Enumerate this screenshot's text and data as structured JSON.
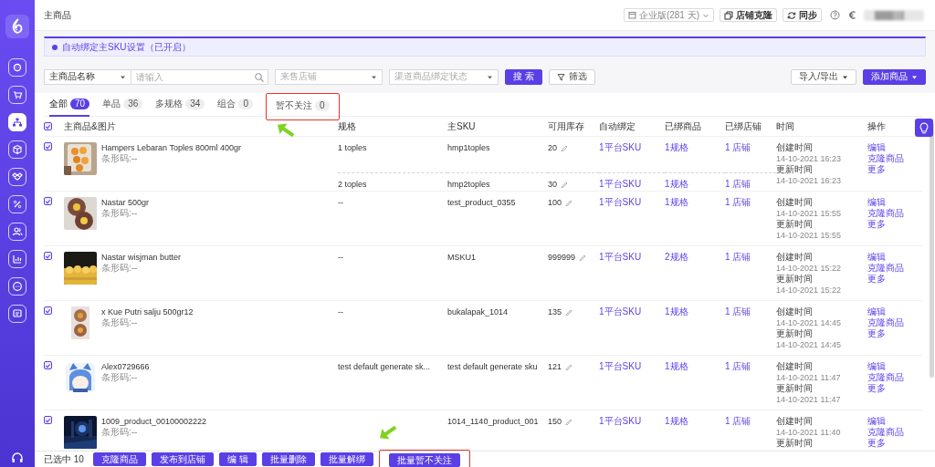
{
  "page_title": "主商品",
  "header": {
    "plan": "企业版(281 天)",
    "clone_button": "店铺克隆",
    "sync_button": "同步"
  },
  "sidebar": {
    "items": [
      {
        "selected": false
      },
      {
        "selected": false
      },
      {
        "selected": true
      },
      {
        "selected": false
      },
      {
        "selected": false
      },
      {
        "selected": false
      },
      {
        "selected": false
      },
      {
        "selected": false
      },
      {
        "selected": false
      },
      {
        "selected": false
      }
    ]
  },
  "notice": "自动绑定主SKU设置（已开启）",
  "filters": {
    "field_select": "主商品名称",
    "keyword_placeholder": "请输入",
    "shop_placeholder": "来售店铺",
    "bind_status_placeholder": "渠道商品绑定状态",
    "search_button": "搜 索",
    "filter_button": "筛选",
    "import_export": "导入/导出",
    "add_product": "添加商品"
  },
  "tabs": [
    {
      "label": "全部",
      "count": "70",
      "selected": true,
      "highlighted": false
    },
    {
      "label": "单品",
      "count": "36",
      "selected": false,
      "highlighted": false
    },
    {
      "label": "多规格",
      "count": "34",
      "selected": false,
      "highlighted": false
    },
    {
      "label": "组合",
      "count": "0",
      "selected": false,
      "highlighted": false
    },
    {
      "label": "暂不关注",
      "count": "0",
      "selected": false,
      "highlighted": true
    }
  ],
  "table": {
    "all_checked": true,
    "columns": [
      "主商品&图片",
      "规格",
      "主SKU",
      "可用库存",
      "自动绑定",
      "已绑商品",
      "已绑店铺",
      "时间",
      "操作"
    ]
  },
  "products": [
    {
      "name": "Hampers Lebaran Toples 800ml 400gr",
      "barcode": "条形码:--",
      "checked": true,
      "variants": [
        {
          "spec": "1 toples",
          "sku": "hmp1toples",
          "stock": "20",
          "auto_bind": "1平台SKU",
          "bound_goods": "1规格",
          "bound_shops": "1 店铺"
        },
        {
          "spec": "2 toples",
          "sku": "hmp2toples",
          "stock": "30",
          "auto_bind": "1平台SKU",
          "bound_goods": "1规格",
          "bound_shops": "1 店铺"
        }
      ],
      "times": [
        "创建时间",
        "14-10-2021 16:23",
        "更新时间",
        "14-10-2021 16:23"
      ],
      "actions": [
        "编辑",
        "克隆商品",
        "更多"
      ]
    },
    {
      "name": "Nastar 500gr",
      "barcode": "条形码:--",
      "checked": true,
      "variants": [
        {
          "spec": "--",
          "sku": "test_product_0355",
          "stock": "100",
          "auto_bind": "1平台SKU",
          "bound_goods": "1规格",
          "bound_shops": "1 店铺"
        }
      ],
      "times": [
        "创建时间",
        "14-10-2021 15:55",
        "更新时间",
        "14-10-2021 15:55"
      ],
      "actions": [
        "编辑",
        "克隆商品",
        "更多"
      ]
    },
    {
      "name": "Nastar wisjman butter",
      "barcode": "条形码:--",
      "checked": true,
      "variants": [
        {
          "spec": "--",
          "sku": "MSKU1",
          "stock": "999999",
          "auto_bind": "1平台SKU",
          "bound_goods": "2规格",
          "bound_shops": "1 店铺"
        }
      ],
      "times": [
        "创建时间",
        "14-10-2021 15:22",
        "更新时间",
        "14-10-2021 15:22"
      ],
      "actions": [
        "编辑",
        "克隆商品",
        "更多"
      ]
    },
    {
      "name": "x Kue Putri salju 500gr12",
      "barcode": "条形码:--",
      "checked": true,
      "variants": [
        {
          "spec": "--",
          "sku": "bukalapak_1014",
          "stock": "135",
          "auto_bind": "1平台SKU",
          "bound_goods": "1规格",
          "bound_shops": "1 店铺"
        }
      ],
      "times": [
        "创建时间",
        "14-10-2021 14:45",
        "更新时间",
        "14-10-2021 14:45"
      ],
      "actions": [
        "编辑",
        "克隆商品",
        "更多"
      ]
    },
    {
      "name": "Alex0729666",
      "barcode": "条形码:--",
      "checked": true,
      "variants": [
        {
          "spec": "test default generate sk...",
          "sku": "test default generate sku",
          "stock": "121",
          "auto_bind": "1平台SKU",
          "bound_goods": "1规格",
          "bound_shops": "1 店铺"
        }
      ],
      "times": [
        "创建时间",
        "14-10-2021 11:47",
        "更新时间",
        "14-10-2021 11:47"
      ],
      "actions": [
        "编辑",
        "克隆商品",
        "更多"
      ]
    },
    {
      "name": "1009_product_00100002222",
      "barcode": "条形码:--",
      "checked": true,
      "variants": [
        {
          "sku": "1014_1140_product_001",
          "stock": "150",
          "auto_bind": "1平台SKU",
          "bound_goods": "1规格",
          "bound_shops": "1 店铺"
        }
      ],
      "times": [
        "创建时间",
        "14-10-2021 11:40",
        "更新时间"
      ],
      "actions": [
        "编辑",
        "克隆商品",
        "更多"
      ]
    }
  ],
  "bulk_bar": {
    "selected_count": "已选中 10",
    "buttons": [
      {
        "label": "克隆商品",
        "highlighted": false
      },
      {
        "label": "发布到店铺",
        "highlighted": false
      },
      {
        "label": "编 辑",
        "highlighted": false
      },
      {
        "label": "批量删除",
        "highlighted": false
      },
      {
        "label": "批量解绑",
        "highlighted": false
      },
      {
        "label": "批量暂不关注",
        "highlighted": true
      }
    ]
  }
}
